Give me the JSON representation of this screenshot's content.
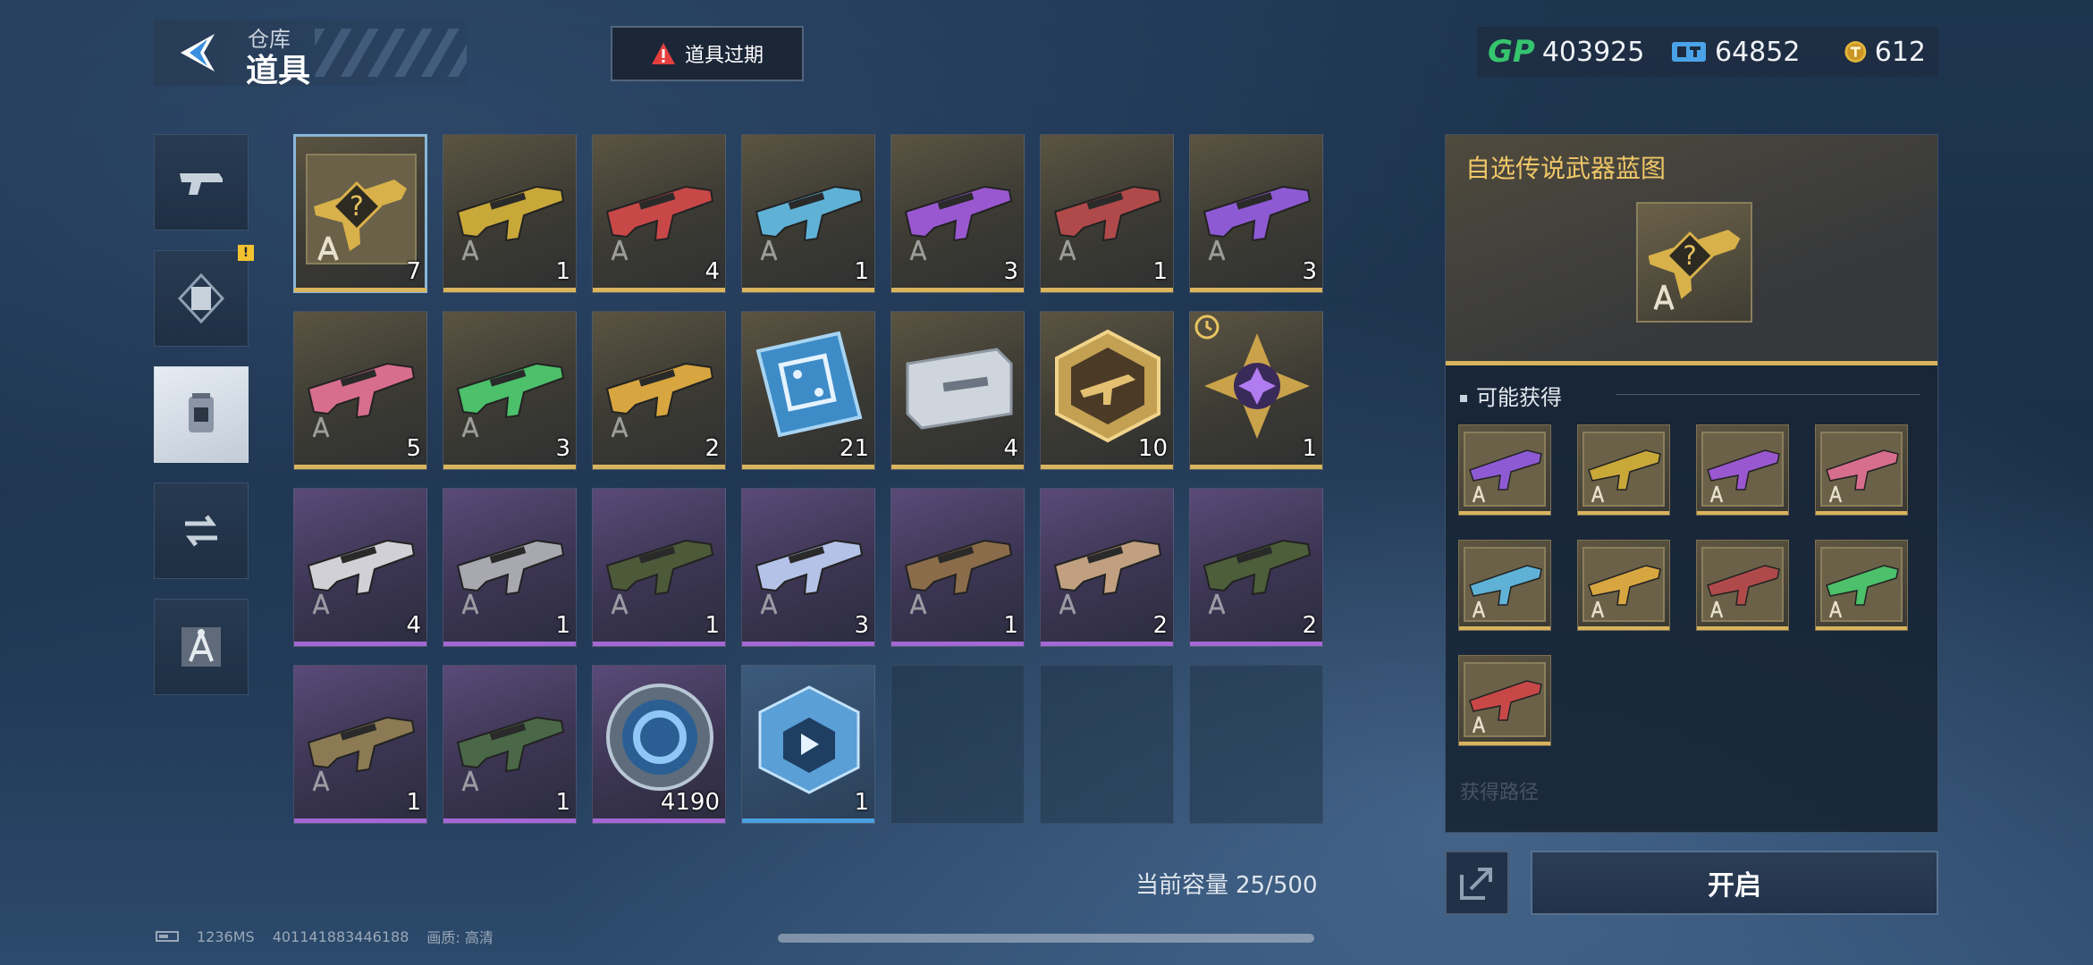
{
  "header": {
    "subtitle": "仓库",
    "title": "道具"
  },
  "alert_button": {
    "label": "道具过期",
    "color": "#e53e3e"
  },
  "currency": {
    "gp": {
      "icon": "gp-icon",
      "label": "GP",
      "value": "403925"
    },
    "ticket": {
      "icon": "ticket-icon",
      "value": "64852"
    },
    "coin": {
      "icon": "coin-icon",
      "value": "612"
    }
  },
  "sidebar": {
    "tabs": [
      {
        "name": "weapons",
        "icon": "pistol-icon",
        "active": false
      },
      {
        "name": "cards",
        "icon": "card-icon",
        "active": false,
        "badge": "!"
      },
      {
        "name": "items",
        "icon": "canister-icon",
        "active": true
      },
      {
        "name": "exchange",
        "icon": "exchange-icon",
        "active": false
      },
      {
        "name": "blueprints",
        "icon": "compass-icon",
        "active": false
      }
    ]
  },
  "inventory": {
    "items": [
      {
        "rarity": "gold",
        "type": "blueprint",
        "count": "7",
        "selected": true
      },
      {
        "rarity": "gold",
        "type": "rifle",
        "count": "1",
        "hue": "#c9a83a"
      },
      {
        "rarity": "gold",
        "type": "rifle",
        "count": "4",
        "hue": "#c84848"
      },
      {
        "rarity": "gold",
        "type": "rifle",
        "count": "1",
        "hue": "#5fb2d6"
      },
      {
        "rarity": "gold",
        "type": "rifle",
        "count": "3",
        "hue": "#9a58d0"
      },
      {
        "rarity": "gold",
        "type": "rifle",
        "count": "1",
        "hue": "#b04a4a"
      },
      {
        "rarity": "gold",
        "type": "rifle",
        "count": "3",
        "hue": "#8e5ad4"
      },
      {
        "rarity": "gold",
        "type": "rifle",
        "count": "5",
        "hue": "#d86e8e"
      },
      {
        "rarity": "gold",
        "type": "rifle",
        "count": "3",
        "hue": "#4cc06a"
      },
      {
        "rarity": "gold",
        "type": "rifle",
        "count": "2",
        "hue": "#d8a640"
      },
      {
        "rarity": "gold",
        "type": "chip",
        "count": "21"
      },
      {
        "rarity": "gold",
        "type": "case",
        "count": "4"
      },
      {
        "rarity": "gold",
        "type": "badge",
        "count": "10"
      },
      {
        "rarity": "gold",
        "type": "emblem",
        "count": "1",
        "timed": true
      },
      {
        "rarity": "purple",
        "type": "rifle",
        "count": "4",
        "hue": "#d0d0d6"
      },
      {
        "rarity": "purple",
        "type": "rifle",
        "count": "1",
        "hue": "#a8a8b0"
      },
      {
        "rarity": "purple",
        "type": "rifle",
        "count": "1",
        "hue": "#4c5a3a"
      },
      {
        "rarity": "purple",
        "type": "rifle",
        "count": "3",
        "hue": "#b4c2e8"
      },
      {
        "rarity": "purple",
        "type": "rifle",
        "count": "1",
        "hue": "#8a6c4a"
      },
      {
        "rarity": "purple",
        "type": "rifle",
        "count": "2",
        "hue": "#c0a080"
      },
      {
        "rarity": "purple",
        "type": "rifle",
        "count": "2",
        "hue": "#4c5e3a"
      },
      {
        "rarity": "purple",
        "type": "rifle",
        "count": "1",
        "hue": "#8c7a54"
      },
      {
        "rarity": "purple",
        "type": "rifle",
        "count": "1",
        "hue": "#4a6848"
      },
      {
        "rarity": "purple",
        "type": "disc",
        "count": "4190"
      },
      {
        "rarity": "blue",
        "type": "cube",
        "count": "1"
      },
      {
        "rarity": "empty"
      },
      {
        "rarity": "empty"
      },
      {
        "rarity": "empty"
      }
    ],
    "capacity_label": "当前容量",
    "capacity_value": "25/500"
  },
  "detail": {
    "title": "自选传说武器蓝图",
    "section_title": "可能获得",
    "faded_section": "获得路径",
    "rewards": [
      {
        "hue": "#8e5ad4"
      },
      {
        "hue": "#c9a83a"
      },
      {
        "hue": "#9a58d0"
      },
      {
        "hue": "#d86e8e"
      },
      {
        "hue": "#5fb2d6"
      },
      {
        "hue": "#d8a640"
      },
      {
        "hue": "#b04a4a"
      },
      {
        "hue": "#4cc06a"
      },
      {
        "hue": "#c84848"
      }
    ],
    "open_label": "开启"
  },
  "footer": {
    "ping": "1236MS",
    "uid": "401141883446188",
    "quality_label": "画质:",
    "quality_value": "高清"
  }
}
